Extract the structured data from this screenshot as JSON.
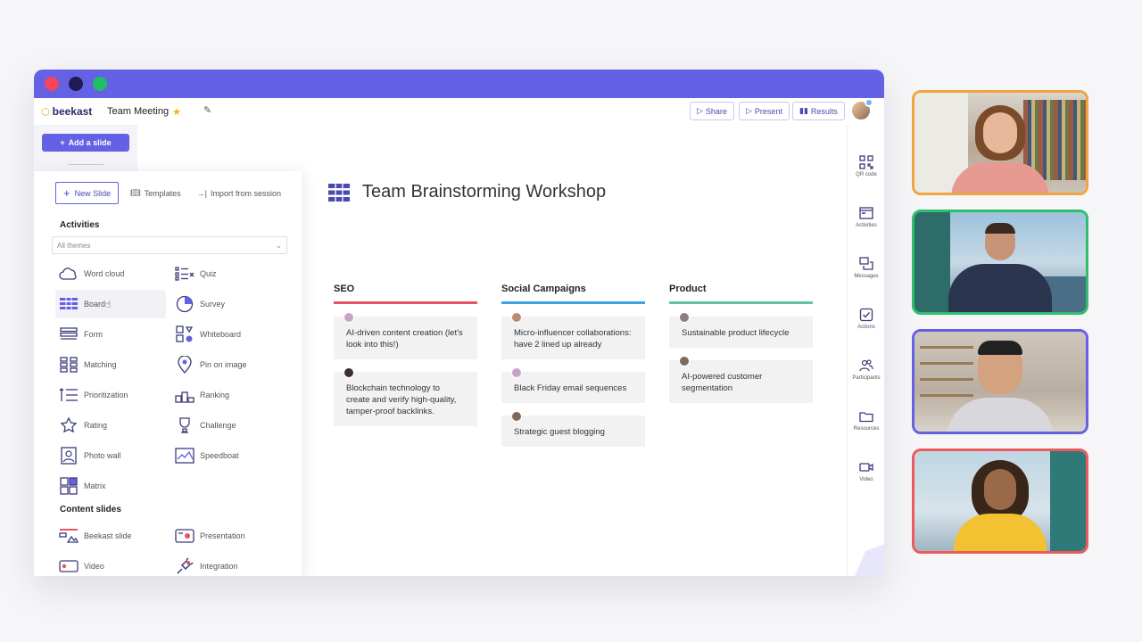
{
  "app": {
    "logo_text": "beekast",
    "doc_title": "Team Meeting"
  },
  "toolbar": {
    "share": "Share",
    "present": "Present",
    "results": "Results"
  },
  "sidebar": {
    "add_slide": "Add a slide"
  },
  "panel": {
    "tabs": {
      "new_slide": "New Slide",
      "templates": "Templates",
      "import": "Import from session"
    },
    "activities_title": "Activities",
    "theme_select": "All themes",
    "activities": [
      "Word cloud",
      "Quiz",
      "Board",
      "Survey",
      "Form",
      "Whiteboard",
      "Matching",
      "Pin on image",
      "Prioritization",
      "Ranking",
      "Rating",
      "Challenge",
      "Photo wall",
      "Speedboat",
      "Matrix"
    ],
    "content_title": "Content slides",
    "content": [
      "Beekast slide",
      "Presentation",
      "Video",
      "Integration"
    ]
  },
  "slide": {
    "title": "Team Brainstorming Workshop",
    "columns": [
      {
        "name": "SEO",
        "color": "#e85263",
        "cards": [
          "AI-driven content creation (let's look into this!)",
          "Blockchain technology to create and verify high-quality, tamper-proof backlinks."
        ]
      },
      {
        "name": "Social Campaigns",
        "color": "#3aa3e3",
        "cards": [
          "Micro-influencer collaborations: have 2 lined up already",
          "Black Friday email sequences",
          "Strategic guest blogging"
        ]
      },
      {
        "name": "Product",
        "color": "#5ec6a4",
        "cards": [
          "Sustainable product lifecycle",
          "AI-powered customer segmentation"
        ]
      }
    ]
  },
  "rightbar": [
    "QR code",
    "Activities",
    "Messages",
    "Actions",
    "Participants",
    "Resources",
    "Video"
  ],
  "videos": {
    "border_colors": [
      "#f0a53e",
      "#2fbf6a",
      "#6461e4",
      "#ec5a5a"
    ]
  }
}
